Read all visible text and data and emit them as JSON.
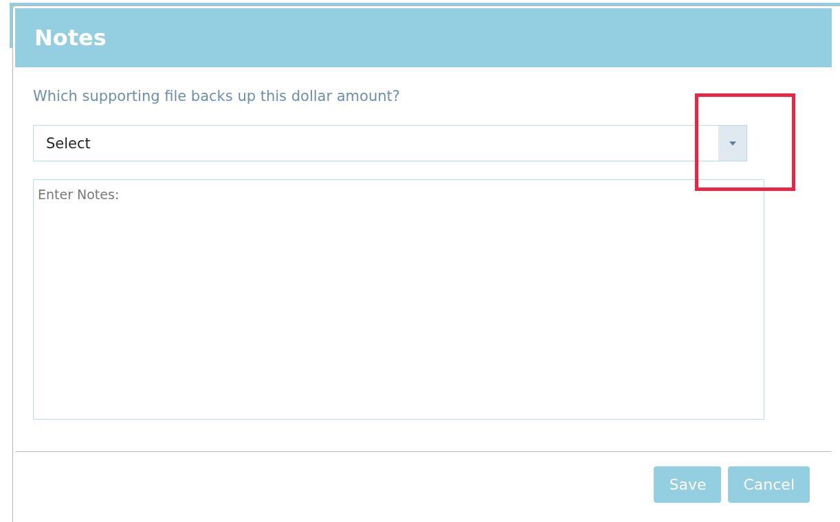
{
  "dialog": {
    "title": "Notes",
    "question": "Which supporting file backs up this dollar amount?",
    "select": {
      "value": "Select"
    },
    "notes": {
      "placeholder": "Enter Notes:"
    },
    "buttons": [
      {
        "label": "Save"
      },
      {
        "label": "Cancel"
      }
    ]
  }
}
